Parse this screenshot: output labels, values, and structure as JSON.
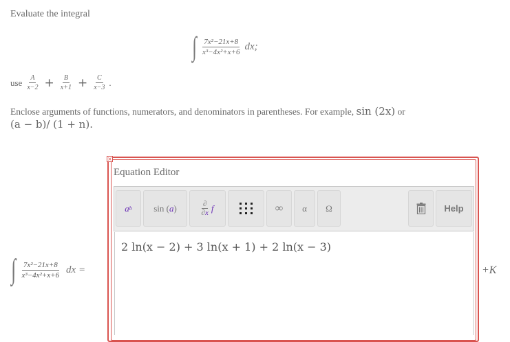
{
  "problem": {
    "intro": "Evaluate the integral",
    "integral": {
      "numerator": "7x²−21x+8",
      "denominator": "x³−4x²+x+6",
      "differential": "dx;"
    },
    "use_prefix": "use",
    "partial_fractions": [
      {
        "num": "A",
        "den": "x−2"
      },
      {
        "num": "B",
        "den": "x+1"
      },
      {
        "num": "C",
        "den": "x−3"
      }
    ],
    "plus_sign": "+",
    "use_suffix": ".",
    "instructions": "Enclose arguments of functions, numerators, and denominators in parentheses. For example,",
    "example_sin": "sin (2x)",
    "example_or": "or",
    "example_frac": "(a − b)/ (1 + n)."
  },
  "equation_left": {
    "numerator": "7x²−21x+8",
    "denominator": "x³−4x²+x+6",
    "dx_equals": "dx ="
  },
  "editor": {
    "close_glyph": "×",
    "title": "Equation Editor",
    "toolbar": {
      "power": "a",
      "power_sup": "b",
      "sin_prefix": "sin (",
      "sin_arg": "a",
      "sin_suffix": ")",
      "deriv_num": "∂",
      "deriv_den_prefix": "∂",
      "deriv_den_var": "x",
      "deriv_fn": "f",
      "infinity": "∞",
      "alpha": "α",
      "omega": "Ω",
      "help": "Help"
    },
    "expression": "2 ln(x − 2) + 3 ln(x + 1) + 2 ln(x − 3)"
  },
  "constant": "+K",
  "colors": {
    "accent_red": "#d9534f",
    "purple": "#6a2fb5"
  },
  "icons": {
    "matrix": "matrix-icon",
    "trash": "trash-icon"
  }
}
